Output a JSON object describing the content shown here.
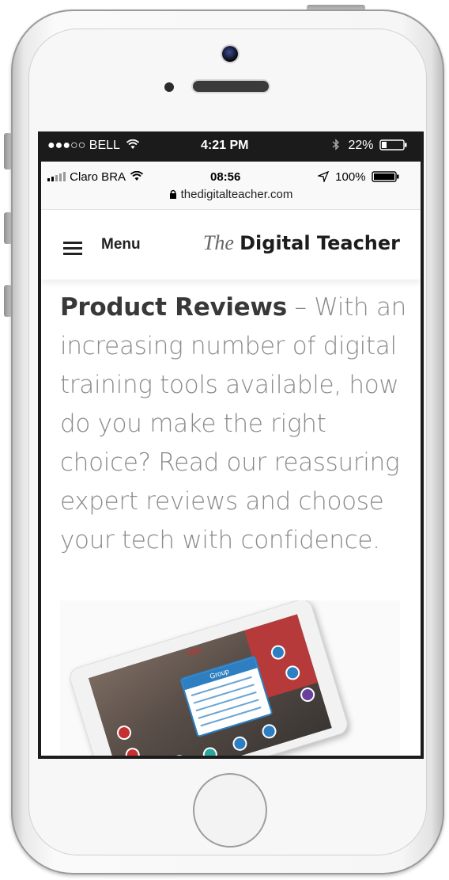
{
  "outer_status": {
    "carrier": "●●●○○ BELL",
    "time": "4:21 PM",
    "battery": "22%"
  },
  "inner_status": {
    "carrier": "Claro BRA",
    "time": "08:56",
    "battery": "100%",
    "url": "thedigitalteacher.com"
  },
  "header": {
    "menu_label": "Menu",
    "brand_prefix": "The",
    "brand_name": "Digital Teacher"
  },
  "article": {
    "bold_lead": "Product Reviews",
    "body": " – With an increasing number of digital training tools available, how do you make the right choice? Read our reassuring expert reviews and choose your tech with confidence."
  },
  "product_image": {
    "app_name": "VEO",
    "panel_title": "Group"
  },
  "colors": {
    "accent_blue": "#2d7fc1",
    "accent_red": "#b73a3a"
  }
}
